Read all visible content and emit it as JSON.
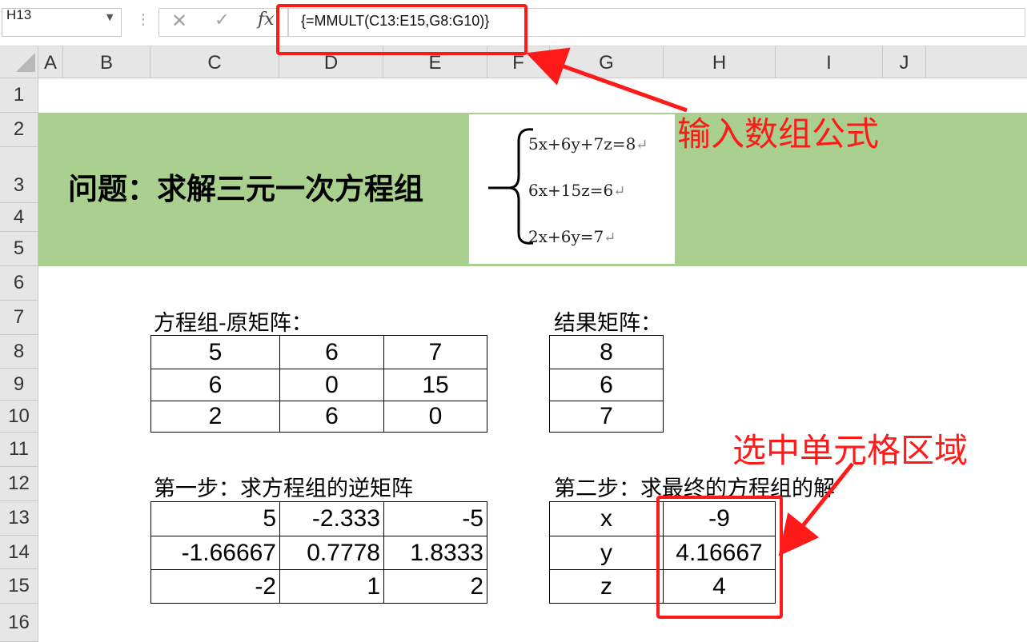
{
  "formula_bar": {
    "name_box": "H13",
    "formula": "{=MMULT(C13:E15,G8:G10)}",
    "icons": [
      "cancel-icon",
      "enter-icon",
      "fx-icon"
    ]
  },
  "columns": [
    "A",
    "B",
    "C",
    "D",
    "E",
    "F",
    "G",
    "H",
    "I",
    "J"
  ],
  "rows": [
    "1",
    "2",
    "3",
    "4",
    "5",
    "6",
    "7",
    "8",
    "9",
    "10",
    "11",
    "12",
    "13",
    "14",
    "15",
    "16"
  ],
  "banner": {
    "title": "问题：求解三元一次方程组",
    "equations": [
      "5x+6y+7z=8",
      "6x+15z=6",
      "2x+6y=7"
    ],
    "return_mark": "↵"
  },
  "labels": {
    "original_matrix": "方程组-原矩阵：",
    "result_matrix": "结果矩阵：",
    "step1": "第一步：求方程组的逆矩阵",
    "step2": "第二步：求最终的方程组的解"
  },
  "original_matrix": [
    [
      "5",
      "6",
      "7"
    ],
    [
      "6",
      "0",
      "15"
    ],
    [
      "2",
      "6",
      "0"
    ]
  ],
  "result_matrix": [
    "8",
    "6",
    "7"
  ],
  "inverse_matrix": [
    [
      "5",
      "-2.333",
      "-5"
    ],
    [
      "-1.66667",
      "0.7778",
      "1.8333"
    ],
    [
      "-2",
      "1",
      "2"
    ]
  ],
  "solution": {
    "vars": [
      "x",
      "y",
      "z"
    ],
    "values": [
      "-9",
      "4.16667",
      "4"
    ]
  },
  "annotations": {
    "formula_callout": "输入数组公式",
    "range_callout": "选中单元格区域",
    "color": "#ff1a1a"
  },
  "colors": {
    "banner": "#a9d08e",
    "header_bg": "#e6e6e6"
  }
}
